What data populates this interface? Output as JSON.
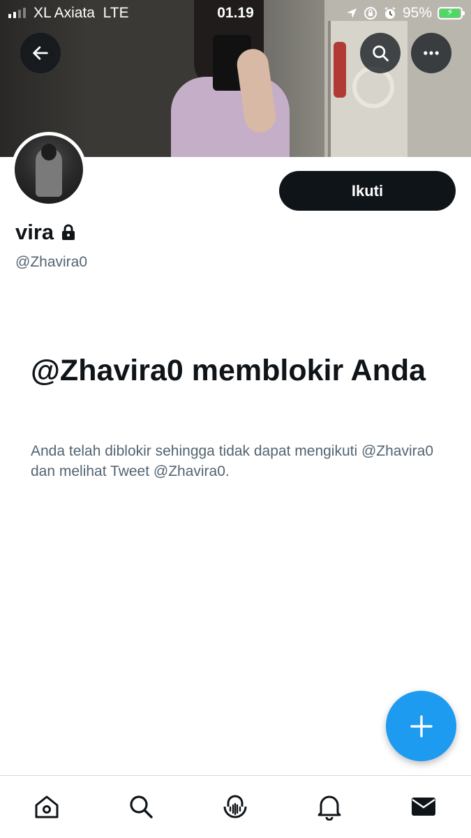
{
  "status_bar": {
    "carrier": "XL Axiata",
    "network": "LTE",
    "time": "01.19",
    "battery_percent": "95%",
    "battery_level": 0.95,
    "charging": true
  },
  "header": {
    "back_icon": "arrow-left-icon",
    "search_icon": "search-icon",
    "more_icon": "more-horizontal-icon"
  },
  "profile": {
    "display_name": "vira",
    "protected_icon": "lock-icon",
    "handle": "@Zhavira0",
    "follow_label": "Ikuti"
  },
  "blocked": {
    "title": "@Zhavira0 memblokir Anda",
    "message": "Anda telah diblokir sehingga tidak dapat mengikuti @Zhavira0 dan melihat Tweet @Zhavira0."
  },
  "fab": {
    "icon": "plus-icon",
    "color": "#1d9bf0"
  },
  "bottom_nav": [
    {
      "icon": "home-icon"
    },
    {
      "icon": "search-icon"
    },
    {
      "icon": "spaces-icon"
    },
    {
      "icon": "bell-icon"
    },
    {
      "icon": "mail-icon"
    }
  ],
  "colors": {
    "primary_text": "#0f1419",
    "secondary_text": "#536471",
    "accent": "#1d9bf0"
  }
}
